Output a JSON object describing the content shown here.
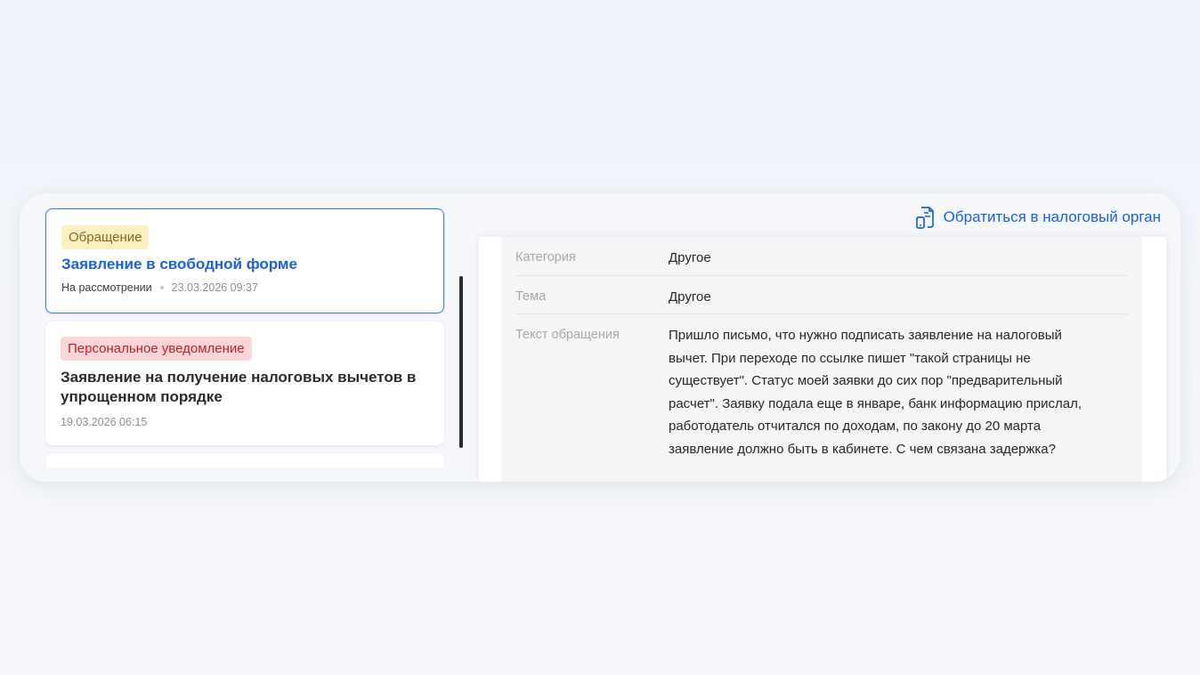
{
  "list": {
    "items": [
      {
        "badge": "Обращение",
        "title": "Заявление в свободной форме",
        "status": "На рассмотрении",
        "date": "23.03.2026 09:37"
      },
      {
        "badge": "Персональное уведомление",
        "title": "Заявление на получение налоговых вычетов в упрощенном порядке",
        "date": "19.03.2026 06:15"
      }
    ]
  },
  "header": {
    "action_label": "Обратиться в налоговый орган",
    "action_icon": "document-phone-icon"
  },
  "detail": {
    "rows": [
      {
        "label": "Категория",
        "value": "Другое"
      },
      {
        "label": "Тема",
        "value": "Другое"
      },
      {
        "label": "Текст обращения",
        "value": "Пришло письмо, что нужно подписать заявление на налоговый вычет. При переходе по ссылке пишет \"такой страницы не существует\". Статус моей заявки до сих пор \"предварительный расчет\". Заявку подала еще в январе, банк информацию прислал, работодатель отчитался по доходам, по закону до 20 марта заявление должно быть в кабинете. С чем связана задержка?"
      }
    ]
  },
  "colors": {
    "accent": "#1a63d6",
    "badge_yellow_bg": "#fcefc2",
    "badge_red_bg": "#fbd6d8",
    "badge_red_text": "#c0212e"
  }
}
